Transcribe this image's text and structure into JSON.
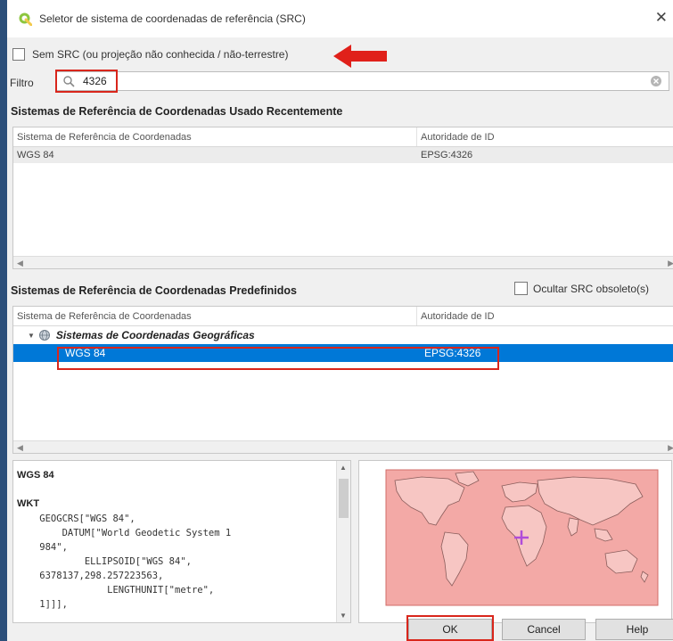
{
  "window": {
    "title": "Seletor de sistema de coordenadas de referência (SRC)",
    "close_glyph": "✕"
  },
  "no_crs": {
    "label": "Sem SRC (ou projeção não conhecida / não-terrestre)",
    "checked": false
  },
  "filter": {
    "label": "Filtro",
    "value": "4326",
    "search_icon": "search-icon",
    "clear_icon": "clear-icon"
  },
  "recent": {
    "title": "Sistemas de Referência de Coordenadas Usado Recentemente",
    "columns": [
      "Sistema de Referência de Coordenadas",
      "Autoridade de ID"
    ],
    "rows": [
      {
        "name": "WGS 84",
        "authority": "EPSG:4326"
      }
    ]
  },
  "predefined": {
    "title": "Sistemas de Referência de Coordenadas Predefinidos",
    "hide_obsolete_label": "Ocultar SRC obsoleto(s)",
    "hide_obsolete_checked": false,
    "columns": [
      "Sistema de Referência de Coordenadas",
      "Autoridade de ID"
    ],
    "group": {
      "label": "Sistemas de Coordenadas Geográficas",
      "expanded": true
    },
    "rows": [
      {
        "name": "WGS 84",
        "authority": "EPSG:4326",
        "selected": true
      }
    ]
  },
  "details": {
    "name": "WGS 84",
    "wkt_label": "WKT",
    "wkt_text": "    GEOGCRS[\"WGS 84\",\n        DATUM[\"World Geodetic System 1\n    984\",\n            ELLIPSOID[\"WGS 84\",\n    6378137,298.257223563,\n                LENGTHUNIT[\"metre\",\n    1]]],"
  },
  "buttons": {
    "ok": "OK",
    "cancel": "Cancel",
    "help": "Help"
  },
  "colors": {
    "selection": "#0078d7",
    "highlight_red": "#d9261c",
    "map_extent": "#f3a9a6",
    "crosshair": "#b04cd9"
  }
}
